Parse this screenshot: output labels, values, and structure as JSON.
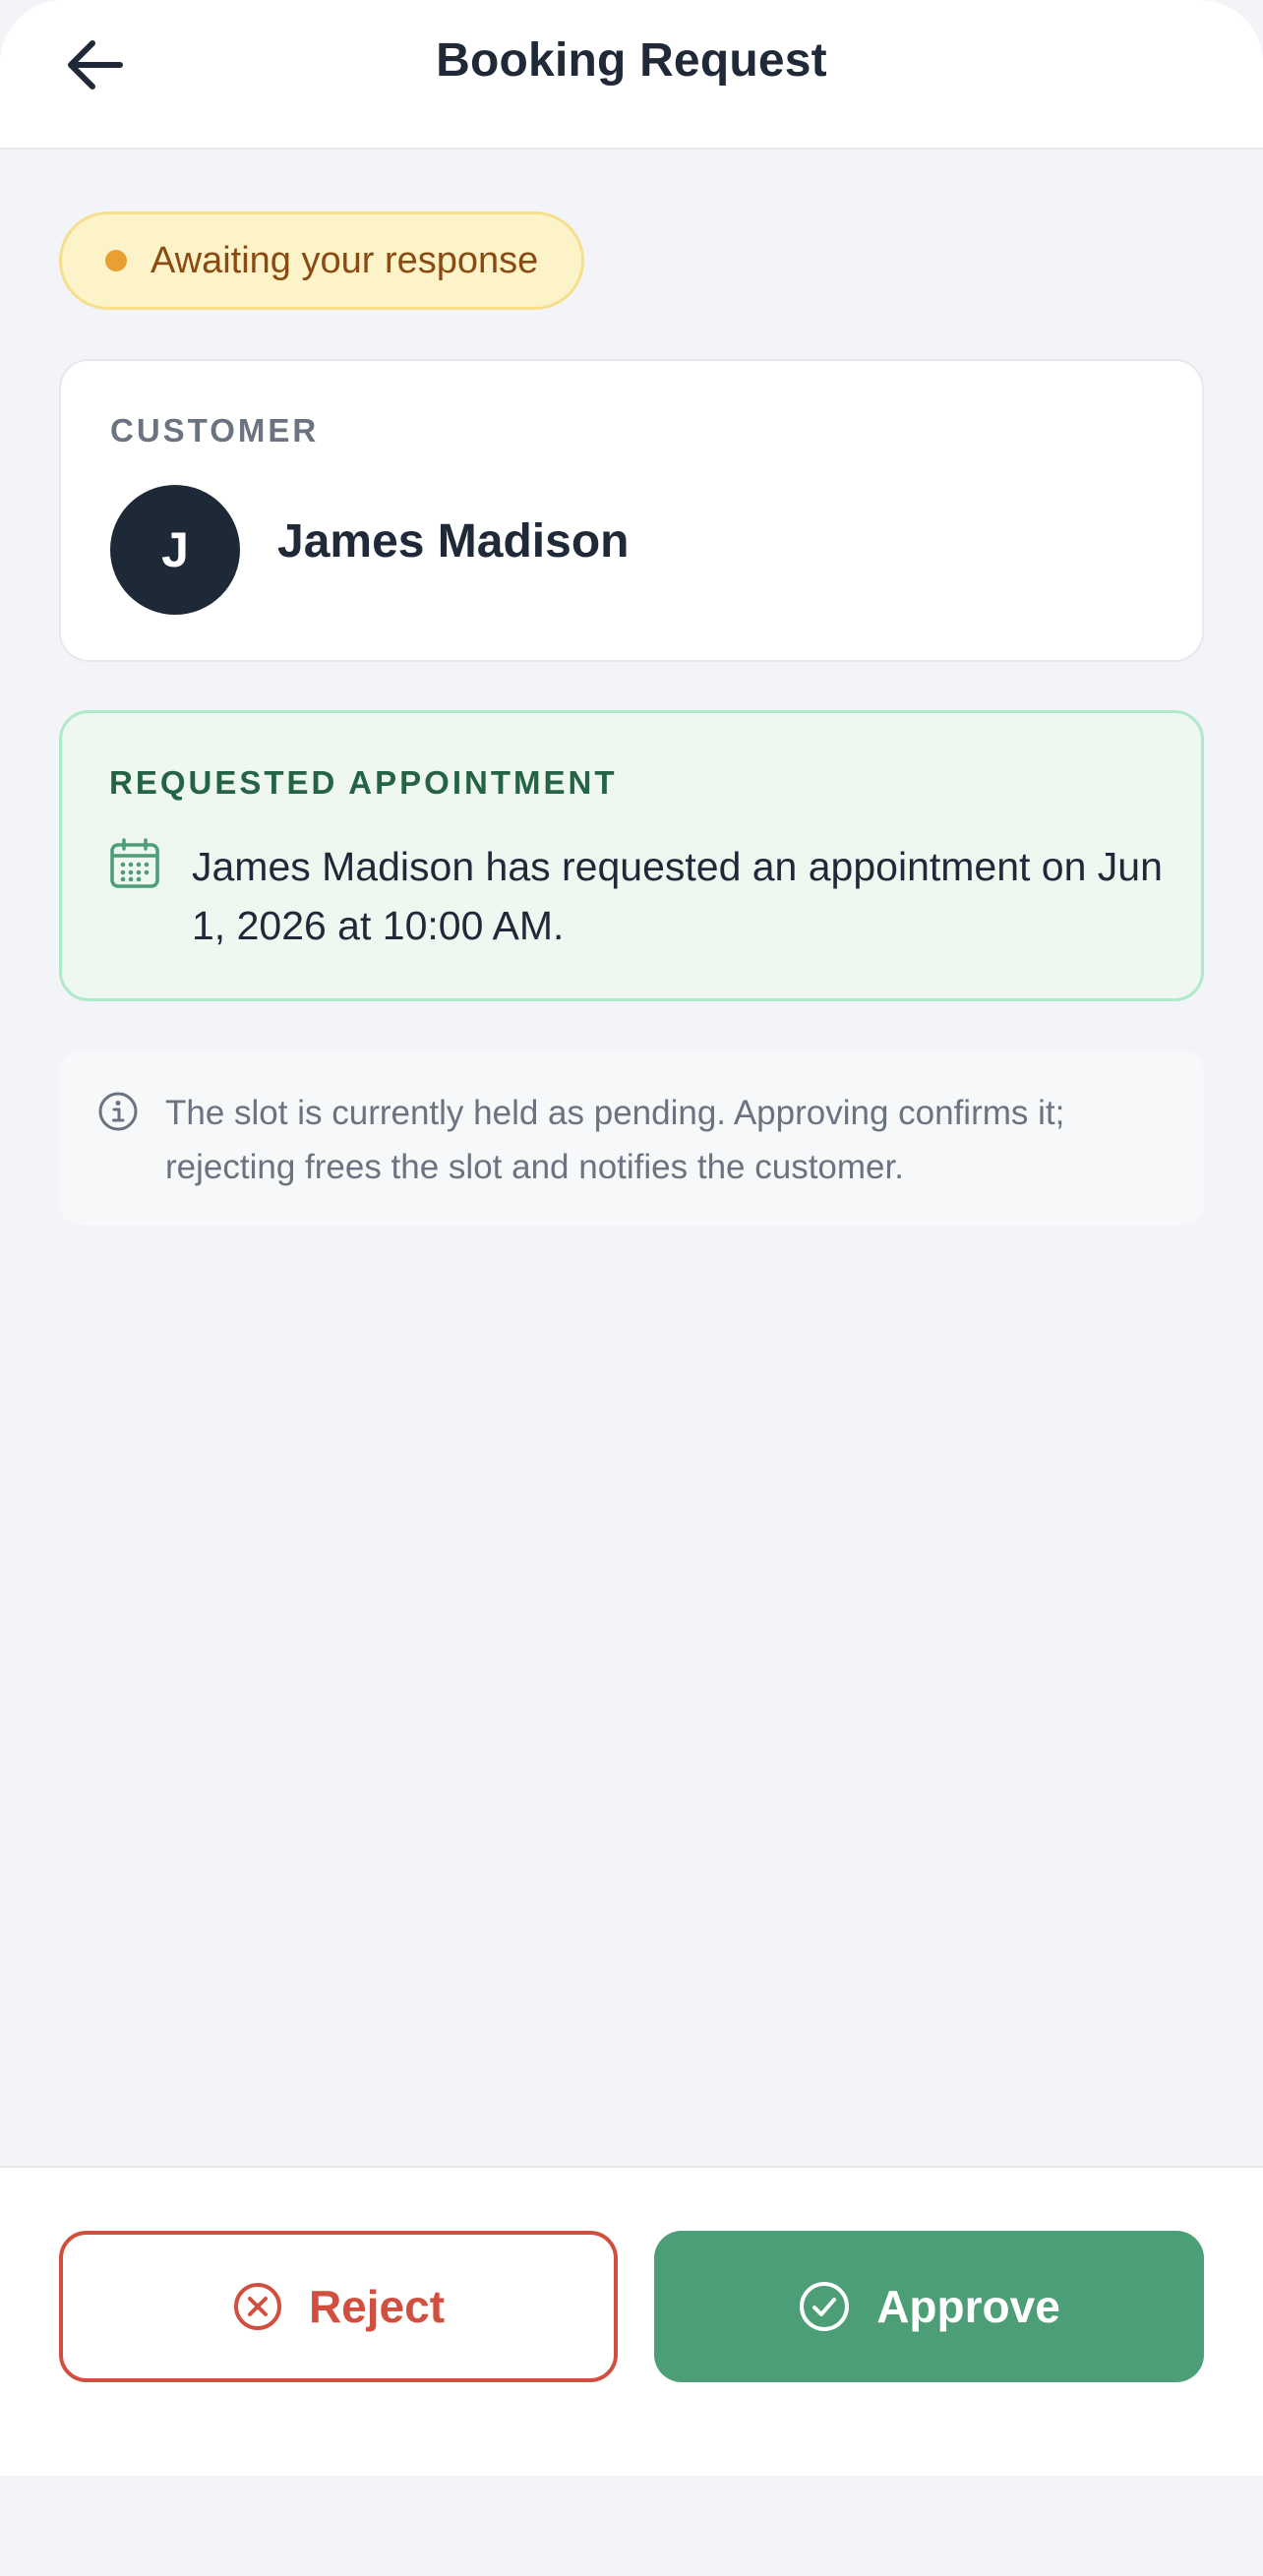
{
  "header": {
    "title": "Booking Request",
    "back_icon": "arrow-left-icon"
  },
  "status": {
    "text": "Awaiting your response",
    "dot_color": "#e9a033"
  },
  "customer": {
    "label": "CUSTOMER",
    "avatar_initial": "J",
    "name": "James Madison"
  },
  "appointment": {
    "label": "REQUESTED APPOINTMENT",
    "icon": "calendar-icon",
    "text": "James Madison has requested an appointment on Jun 1, 2026 at 10:00 AM."
  },
  "info": {
    "icon": "info-icon",
    "text": "The slot is currently held as pending. Approving confirms it; rejecting frees the slot and notifies the customer."
  },
  "actions": {
    "reject_label": "Reject",
    "reject_icon": "x-circle-icon",
    "approve_label": "Approve",
    "approve_icon": "check-circle-icon"
  },
  "colors": {
    "accent_green": "#4b9e76",
    "danger_red": "#d24f3f",
    "pending_yellow": "#fdf3c9"
  }
}
